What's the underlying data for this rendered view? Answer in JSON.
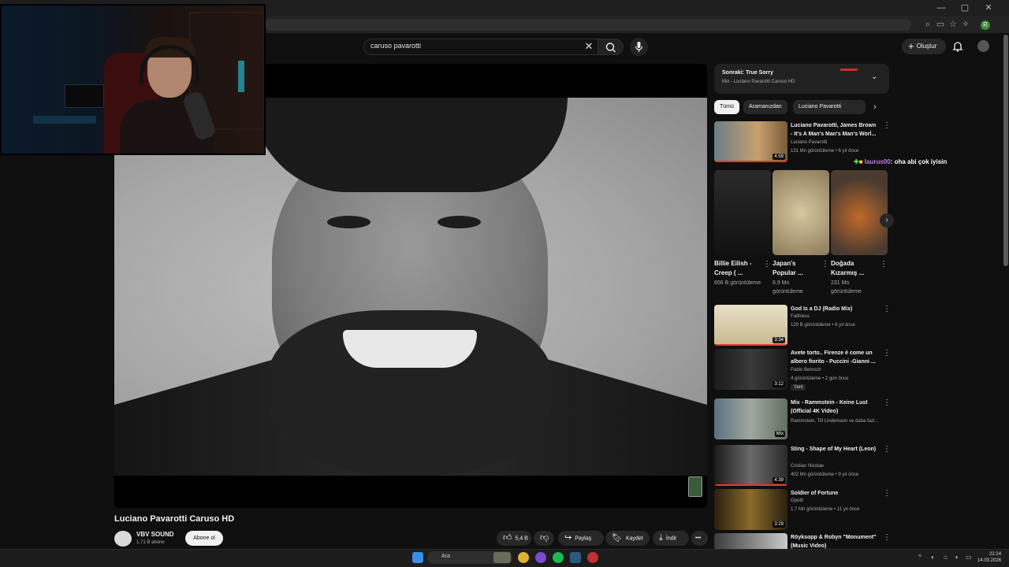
{
  "browser": {
    "window_controls": [
      "—",
      "▢",
      "✕"
    ],
    "addr_icons": [
      "zoom-icon",
      "cast-icon",
      "star-icon",
      "extensions-icon"
    ],
    "profile_letter": "R"
  },
  "header": {
    "search_query": "caruso pavarotti",
    "create_label": "Oluştur"
  },
  "video": {
    "title": "Luciano Pavarotti Caruso HD",
    "channel": "VBV SOUND",
    "subscribers": "1,71 B abone",
    "subscribe_label": "Abone ol",
    "likes": "5,4 B",
    "share_label": "Paylaş",
    "save_label": "Kaydet",
    "download_label": "İndir"
  },
  "up_next": {
    "title": "Sonraki: True Sorry",
    "subtitle": "Mix - Luciano Pavarotti Caruso HD"
  },
  "chips": [
    "Tümü",
    "Aramanızdan",
    "Luciano Pavarotti"
  ],
  "chat": {
    "user": "laurus00",
    "message": ": oha abi çok iyisin"
  },
  "recommendations": [
    {
      "title": "Luciano Pavarotti, James Brown - It's A Man's Man's Man's Worl...",
      "channel": "Luciano Pavarotti",
      "meta": "131 Mn görüntüleme • 6 yıl önce",
      "duration": "4:59",
      "badge": ""
    },
    {
      "title": "God Is a DJ (Radio Mix)",
      "channel": "Faithless",
      "meta": "129 B görüntüleme • 8 yıl önce",
      "duration": "3:34",
      "badge": ""
    },
    {
      "title": "Avete torto.. Firenze è come un albero fiorito - Puccini -Gianni ...",
      "channel": "Pablo Bemsch",
      "meta": "4 görüntüleme • 2 gün önce",
      "duration": "3:12",
      "badge": "Yeni"
    },
    {
      "title": "Mix - Rammstein - Keine Lust (Official 4K Video)",
      "channel": "Rammstein, Till Lindemann ve daha fazl...",
      "meta": "",
      "duration": "Mix",
      "badge": ""
    },
    {
      "title": "Sting - Shape of My Heart (Leon)",
      "channel": "Cristian Nicolae",
      "meta": "402 Mn görüntüleme • 9 yıl önce",
      "duration": "4:39",
      "badge": ""
    },
    {
      "title": "Soldier of Fortune",
      "channel": "Opeth",
      "meta": "1,7 Mn görüntüleme • 11 yıl önce",
      "duration": "3:29",
      "badge": ""
    },
    {
      "title": "Röyksopp & Robyn \"Monument\" (Music Video)",
      "channel": "",
      "meta": "",
      "duration": "",
      "badge": ""
    }
  ],
  "shorts": [
    {
      "title": "Billie Eilish - Creep ( ...",
      "views": "656 B görüntüleme"
    },
    {
      "title": "Japan's Popular ...",
      "views": "6,9 Mn görüntüleme"
    },
    {
      "title": "Doğada Kızarmış ...",
      "views": "231 Mn görüntüleme"
    }
  ],
  "taskbar": {
    "search_label": "Ara",
    "time": "22:24",
    "date": "14.03.2026"
  }
}
